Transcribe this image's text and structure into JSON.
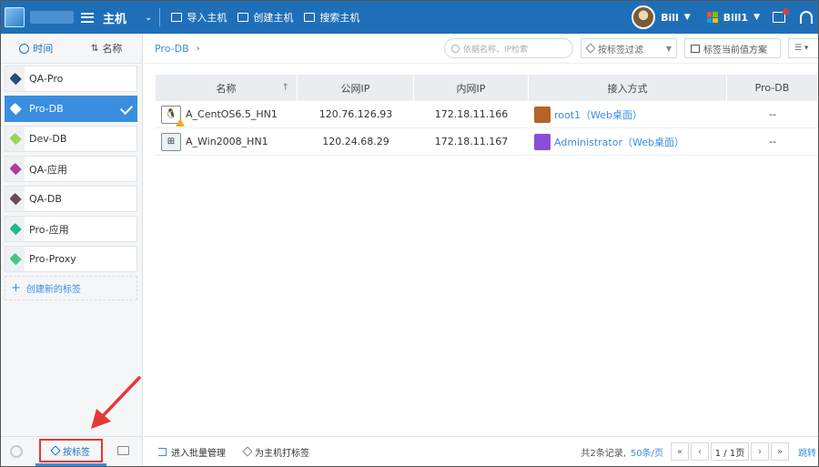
{
  "topbar": {
    "title": "主机",
    "actions": [
      "导入主机",
      "创建主机",
      "搜索主机"
    ],
    "user_name": "Bill",
    "org_name": "Bill1"
  },
  "sidebar": {
    "sort_time": "时间",
    "sort_name": "名称",
    "tags": [
      {
        "label": "QA-Pro",
        "color": "#2a4a78",
        "active": false
      },
      {
        "label": "Pro-DB",
        "color": "#ffffff",
        "active": true
      },
      {
        "label": "Dev-DB",
        "color": "#9bd35a",
        "active": false
      },
      {
        "label": "QA-应用",
        "color": "#b23aa3",
        "active": false
      },
      {
        "label": "QA-DB",
        "color": "#6f4a55",
        "active": false
      },
      {
        "label": "Pro-应用",
        "color": "#24b88a",
        "active": false
      },
      {
        "label": "Pro-Proxy",
        "color": "#45c58c",
        "active": false
      }
    ],
    "new_tag_label": "创建新的标签",
    "bottom_tab_label": "按标签"
  },
  "toolbar": {
    "breadcrumb": "Pro-DB",
    "search_placeholder": "依据名称、IP检索",
    "filter_label": "按标签过滤",
    "view_label": "标签当前值方案"
  },
  "table": {
    "headers": [
      "名称",
      "公网IP",
      "内网IP",
      "接入方式",
      "Pro-DB"
    ],
    "rows": [
      {
        "name": "A_CentOS6.5_HN1",
        "os": "linux",
        "warning": true,
        "public_ip": "120.76.126.93",
        "private_ip": "172.18.11.166",
        "access": "root1（Web桌面）",
        "access_color": "#b4632a",
        "tag_value": "--"
      },
      {
        "name": "A_Win2008_HN1",
        "os": "windows",
        "warning": false,
        "public_ip": "120.24.68.29",
        "private_ip": "172.18.11.167",
        "access": "Administrator（Web桌面）",
        "access_color": "#8a4fd8",
        "tag_value": "--"
      }
    ]
  },
  "bottom": {
    "batch_label": "进入批量管理",
    "tag_host_label": "为主机打标签",
    "records": "共2条记录,",
    "per_page": "50条/页",
    "page_info": "1 / 1页",
    "jump": "跳转"
  }
}
